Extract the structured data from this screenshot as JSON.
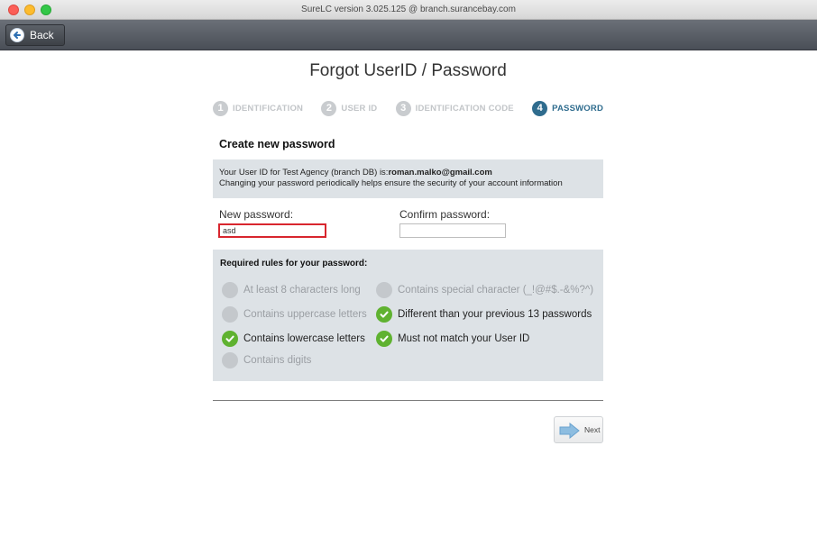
{
  "window": {
    "title": "SureLC version 3.025.125 @ branch.surancebay.com"
  },
  "toolbar": {
    "back_label": "Back"
  },
  "page": {
    "title": "Forgot UserID / Password"
  },
  "steps": [
    {
      "num": "1",
      "label": "IDENTIFICATION",
      "state": "done"
    },
    {
      "num": "2",
      "label": "USER ID",
      "state": "done"
    },
    {
      "num": "3",
      "label": "IDENTIFICATION CODE",
      "state": "done"
    },
    {
      "num": "4",
      "label": "PASSWORD",
      "state": "active"
    }
  ],
  "section": {
    "heading": "Create new password"
  },
  "info": {
    "line1_prefix": "Your User ID for Test Agency (branch DB) is:",
    "user_id": "roman.malko@gmail.com",
    "line2": "Changing your password periodically helps ensure the security of your account information"
  },
  "form": {
    "new_password_label": "New password:",
    "new_password_value": "asd",
    "confirm_password_label": "Confirm password:",
    "confirm_password_value": ""
  },
  "rules": {
    "heading": "Required rules for your password:",
    "items": [
      {
        "text": "At least 8 characters long",
        "met": false
      },
      {
        "text": "Contains special character (_!@#$.-&%?^)",
        "met": false
      },
      {
        "text": "Contains uppercase letters",
        "met": false
      },
      {
        "text": "Different than your previous 13 passwords",
        "met": true
      },
      {
        "text": "Contains lowercase letters",
        "met": true
      },
      {
        "text": "Must not match your User ID",
        "met": true
      },
      {
        "text": "Contains digits",
        "met": false
      }
    ]
  },
  "actions": {
    "next_label": "Next"
  },
  "colors": {
    "accent": "#2f6c8e",
    "success": "#5fb230",
    "error": "#d8262e",
    "panel": "#dde2e6"
  }
}
